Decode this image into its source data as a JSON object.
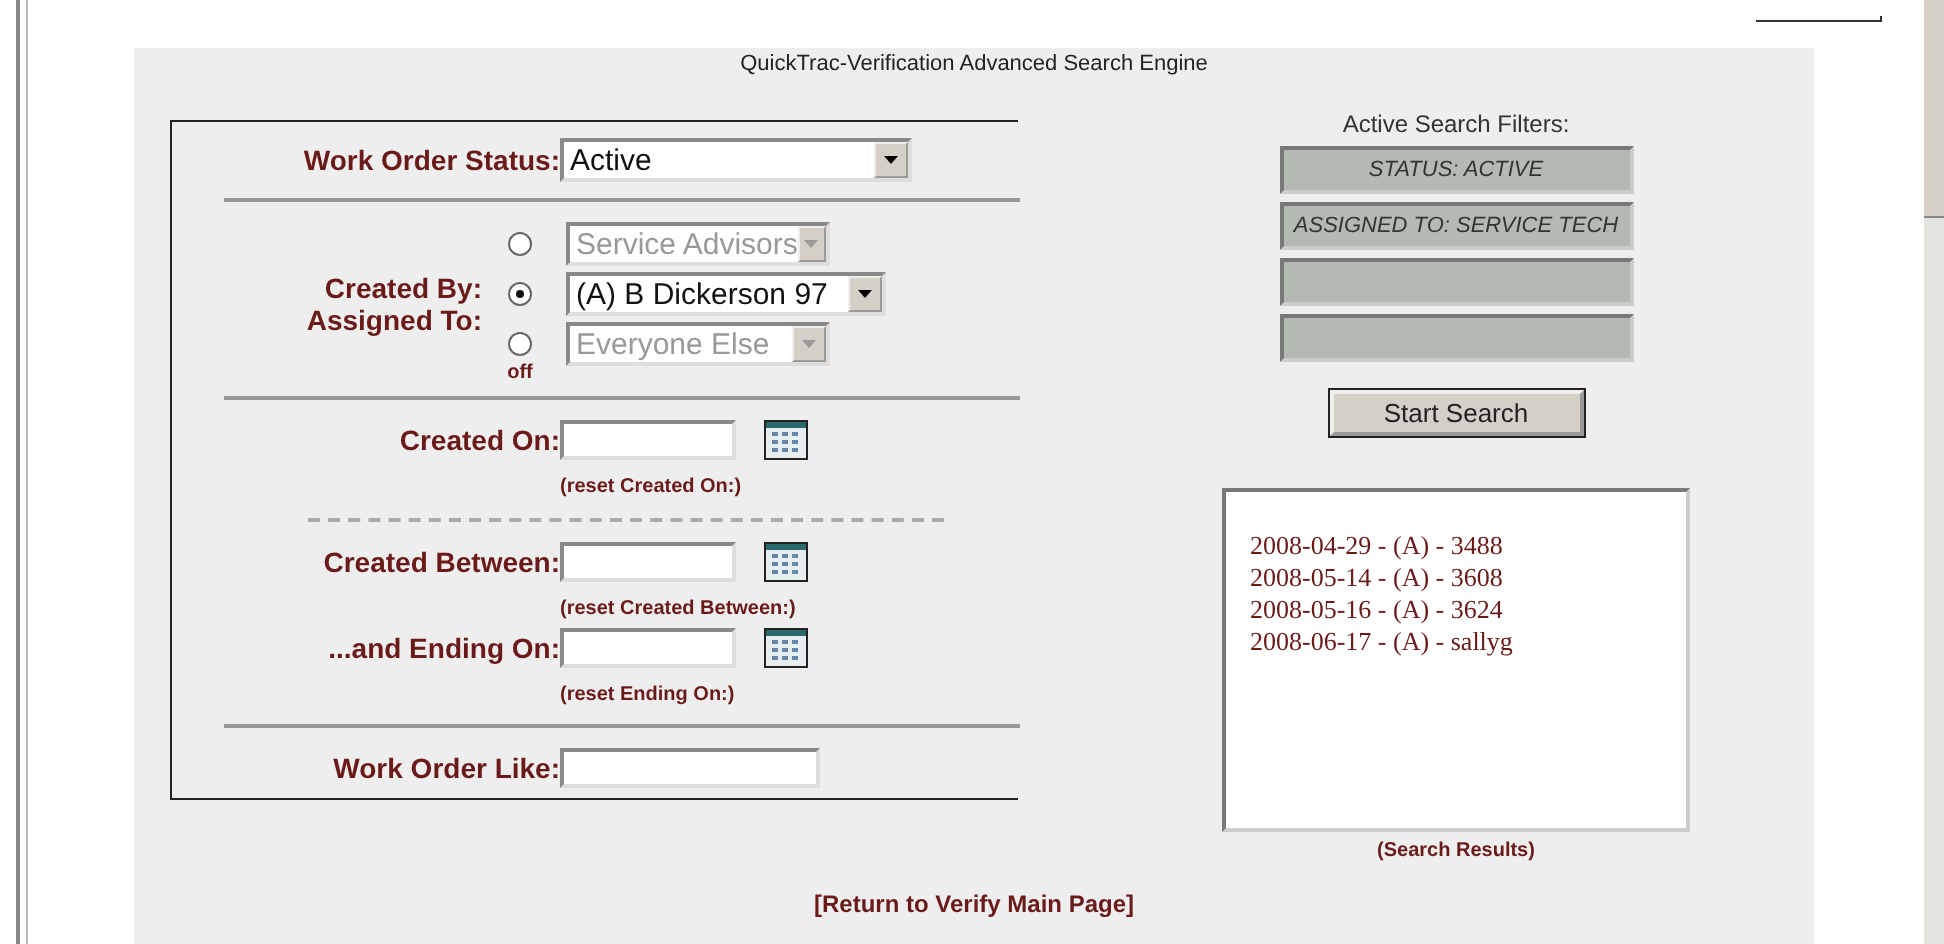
{
  "title": "QuickTrac-Verification Advanced Search Engine",
  "status": {
    "label": "Work Order Status:",
    "value": "Active"
  },
  "people": {
    "labels": [
      "Created By:",
      "Assigned To:"
    ],
    "off_label": "off",
    "options": [
      {
        "value": "Service Advisors",
        "selected": false,
        "disabled": true
      },
      {
        "value": "(A) B Dickerson 97",
        "selected": true,
        "disabled": false
      },
      {
        "value": "Everyone Else",
        "selected": false,
        "disabled": true
      }
    ]
  },
  "created_on": {
    "label": "Created On:",
    "reset": "(reset Created On:)"
  },
  "created_between": {
    "label": "Created Between:",
    "reset": "(reset Created Between:)"
  },
  "ending_on": {
    "label": "...and Ending On:",
    "reset": "(reset Ending On:)"
  },
  "work_order_like": {
    "label": "Work Order Like:"
  },
  "filters": {
    "title": "Active Search Filters:",
    "items": [
      "STATUS: ACTIVE",
      "ASSIGNED TO: SERVICE TECH"
    ]
  },
  "search_button": "Start Search",
  "results": {
    "items": [
      "2008-04-29 - (A) - 3488",
      "2008-05-14 - (A) - 3608",
      "2008-05-16 - (A) - 3624",
      "2008-06-17 - (A) - sallyg"
    ],
    "caption": "(Search Results)"
  },
  "return_link": "[Return to Verify Main Page]"
}
